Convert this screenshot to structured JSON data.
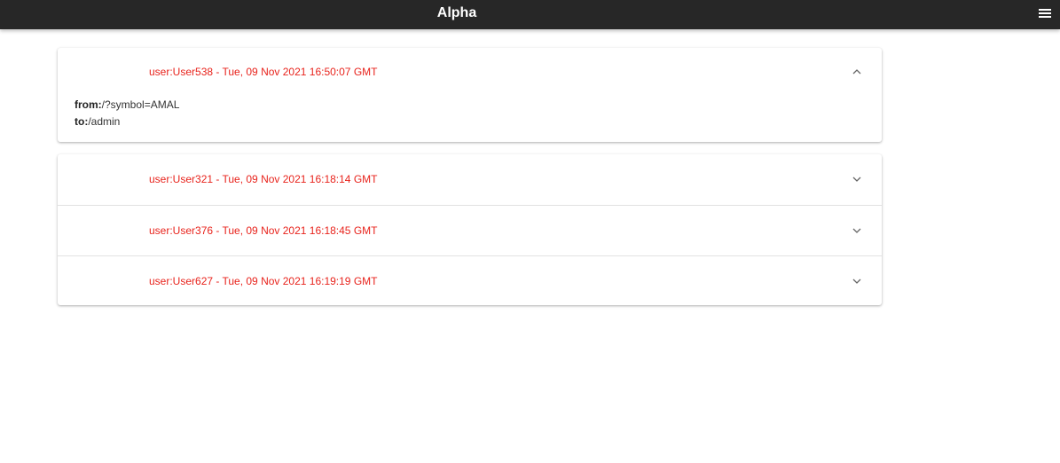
{
  "app": {
    "title": "Alpha",
    "menu_icon": "hamburger-menu-icon"
  },
  "colors": {
    "topbar": "#272727",
    "accent_text": "#e8231c"
  },
  "expanded_entry": {
    "label": "user:User538 - Tue, 09 Nov 2021 16:50:07 GMT",
    "from_label": "from:",
    "from_value": "/?symbol=AMAL",
    "to_label": "to:",
    "to_value": "/admin",
    "icon": "chevron-up-icon"
  },
  "entries": [
    {
      "label": "user:User321 - Tue, 09 Nov 2021 16:18:14 GMT",
      "icon": "chevron-down-icon"
    },
    {
      "label": "user:User376 - Tue, 09 Nov 2021 16:18:45 GMT",
      "icon": "chevron-down-icon"
    },
    {
      "label": "user:User627 - Tue, 09 Nov 2021 16:19:19 GMT",
      "icon": "chevron-down-icon"
    }
  ]
}
